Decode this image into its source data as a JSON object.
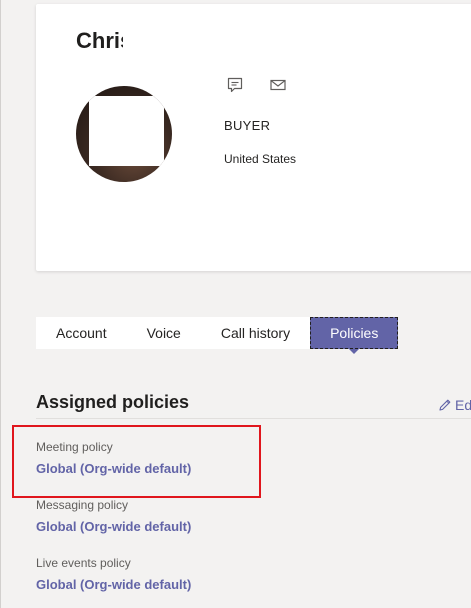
{
  "user": {
    "name": "Chris",
    "title": "BUYER",
    "country": "United States"
  },
  "actions": {
    "chat_icon": "chat-icon",
    "mail_icon": "mail-icon"
  },
  "tabs": [
    {
      "label": "Account",
      "active": false
    },
    {
      "label": "Voice",
      "active": false
    },
    {
      "label": "Call history",
      "active": false
    },
    {
      "label": "Policies",
      "active": true
    }
  ],
  "section": {
    "title": "Assigned policies",
    "edit_label": "Ed"
  },
  "policies": [
    {
      "label": "Meeting policy",
      "value": "Global (Org-wide default)"
    },
    {
      "label": "Messaging policy",
      "value": "Global (Org-wide default)"
    },
    {
      "label": "Live events policy",
      "value": "Global (Org-wide default)"
    }
  ],
  "colors": {
    "accent": "#6264a7",
    "highlight": "#e0161d",
    "background": "#f3f2f1"
  }
}
